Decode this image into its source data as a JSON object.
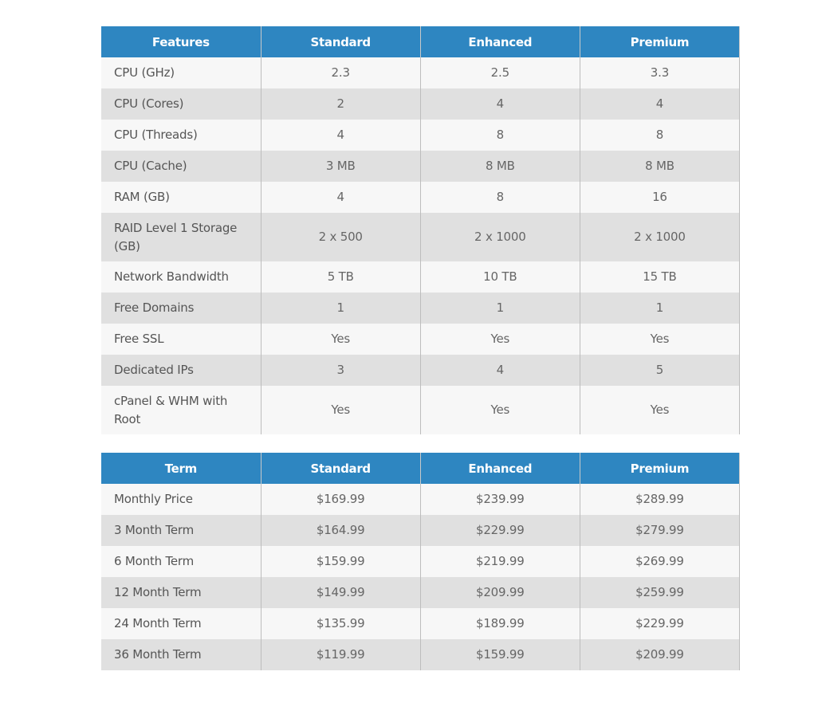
{
  "features_table": {
    "headers": [
      "Features",
      "Standard",
      "Enhanced",
      "Premium"
    ],
    "rows": [
      {
        "label": "CPU (GHz)",
        "values": [
          "2.3",
          "2.5",
          "3.3"
        ]
      },
      {
        "label": "CPU (Cores)",
        "values": [
          "2",
          "4",
          "4"
        ]
      },
      {
        "label": "CPU (Threads)",
        "values": [
          "4",
          "8",
          "8"
        ]
      },
      {
        "label": "CPU (Cache)",
        "values": [
          "3 MB",
          "8 MB",
          "8 MB"
        ]
      },
      {
        "label": "RAM (GB)",
        "values": [
          "4",
          "8",
          "16"
        ]
      },
      {
        "label": "RAID Level 1 Storage (GB)",
        "values": [
          "2 x 500",
          "2 x 1000",
          "2 x 1000"
        ]
      },
      {
        "label": "Network Bandwidth",
        "values": [
          "5 TB",
          "10 TB",
          "15 TB"
        ]
      },
      {
        "label": "Free Domains",
        "values": [
          "1",
          "1",
          "1"
        ]
      },
      {
        "label": "Free SSL",
        "values": [
          "Yes",
          "Yes",
          "Yes"
        ]
      },
      {
        "label": "Dedicated IPs",
        "values": [
          "3",
          "4",
          "5"
        ]
      },
      {
        "label": "cPanel & WHM with Root",
        "values": [
          "Yes",
          "Yes",
          "Yes"
        ]
      }
    ]
  },
  "pricing_table": {
    "headers": [
      "Term",
      "Standard",
      "Enhanced",
      "Premium"
    ],
    "rows": [
      {
        "label": "Monthly Price",
        "values": [
          "$169.99",
          "$239.99",
          "$289.99"
        ]
      },
      {
        "label": "3 Month Term",
        "values": [
          "$164.99",
          "$229.99",
          "$279.99"
        ]
      },
      {
        "label": "6 Month Term",
        "values": [
          "$159.99",
          "$219.99",
          "$269.99"
        ]
      },
      {
        "label": "12 Month Term",
        "values": [
          "$149.99",
          "$209.99",
          "$259.99"
        ]
      },
      {
        "label": "24 Month Term",
        "values": [
          "$135.99",
          "$189.99",
          "$229.99"
        ]
      },
      {
        "label": "36 Month Term",
        "values": [
          "$119.99",
          "$159.99",
          "$209.99"
        ]
      }
    ]
  },
  "colors": {
    "header_bg": "#2e86c1",
    "header_text": "#ffffff",
    "row_light": "#f7f7f7",
    "row_dark": "#e0e0e0",
    "cell_text": "#666666"
  }
}
